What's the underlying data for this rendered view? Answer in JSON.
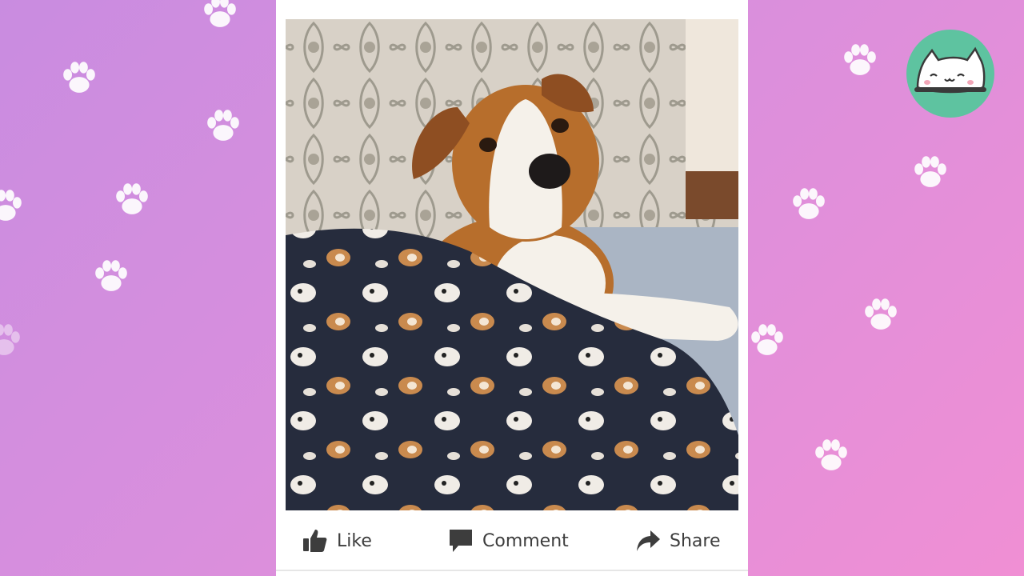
{
  "actions": {
    "like": {
      "label": "Like",
      "icon": "thumbs-up-icon"
    },
    "comment": {
      "label": "Comment",
      "icon": "speech-bubble-icon"
    },
    "share": {
      "label": "Share",
      "icon": "share-arrow-icon"
    }
  },
  "photo": {
    "subject": "dog"
  },
  "colors": {
    "background_left": "#c98ce0",
    "background_right": "#f08fd4",
    "card": "#ffffff",
    "action_text": "#3d3d3d",
    "logo_badge": "#5ec3a0"
  },
  "decor": {
    "paw_icon": "paw-print-icon",
    "logo": "cat-mascot-icon"
  }
}
